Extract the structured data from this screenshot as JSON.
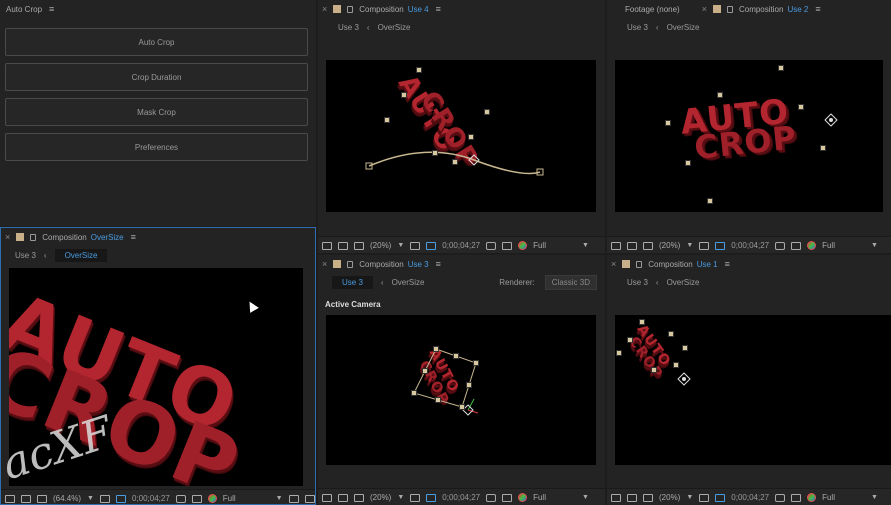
{
  "autocrop_panel": {
    "title": "Auto Crop",
    "buttons": [
      "Auto Crop",
      "Crop Duration",
      "Mask Crop",
      "Preferences"
    ]
  },
  "viewers": {
    "large": {
      "tab_prefix": "Composition",
      "tab_name": "OverSize",
      "crumb_parent": "Use 3",
      "crumb_active": "OverSize",
      "zoom": "(64.4%)",
      "time": "0;00;04;27",
      "resolution": "Full",
      "art_line1": "AUTO",
      "art_line2": "CROP"
    },
    "top_middle": {
      "tab_prefix": "Composition",
      "tab_name": "Use 4",
      "crumb_parent": "Use 3",
      "crumb_active": "OverSize",
      "zoom": "(20%)",
      "time": "0;00;04;27",
      "resolution": "Full",
      "art_line1": "AUTO",
      "art_line2": "CROP"
    },
    "top_right": {
      "footage_tab": "Footage  (none)",
      "tab_prefix": "Composition",
      "tab_name": "Use 2",
      "crumb_parent": "Use 3",
      "crumb_active": "OverSize",
      "zoom": "(20%)",
      "time": "0;00;04;27",
      "resolution": "Full",
      "art_line1": "AUTO",
      "art_line2": "CROP"
    },
    "bottom_middle": {
      "tab_prefix": "Composition",
      "tab_name": "Use 3",
      "crumb_parent": "Use 3",
      "crumb_active": "OverSize",
      "renderer_label": "Renderer:",
      "renderer_value": "Classic 3D",
      "camera_label": "Active Camera",
      "zoom": "(20%)",
      "time": "0;00;04;27",
      "resolution": "Full",
      "art_line1": "AUTO",
      "art_line2": "CROP"
    },
    "bottom_right": {
      "tab_prefix": "Composition",
      "tab_name": "Use 1",
      "crumb_parent": "Use 3",
      "crumb_active": "OverSize",
      "zoom": "(20%)",
      "time": "0;00;04;27",
      "resolution": "Full",
      "art_line1": "AUTO",
      "art_line2": "CROP"
    }
  },
  "watermark": "acXF",
  "colors": {
    "accent": "#4a9be0",
    "text_red": "#b3262f",
    "handle": "#d8c8a0",
    "label_square": "#c9b088"
  }
}
